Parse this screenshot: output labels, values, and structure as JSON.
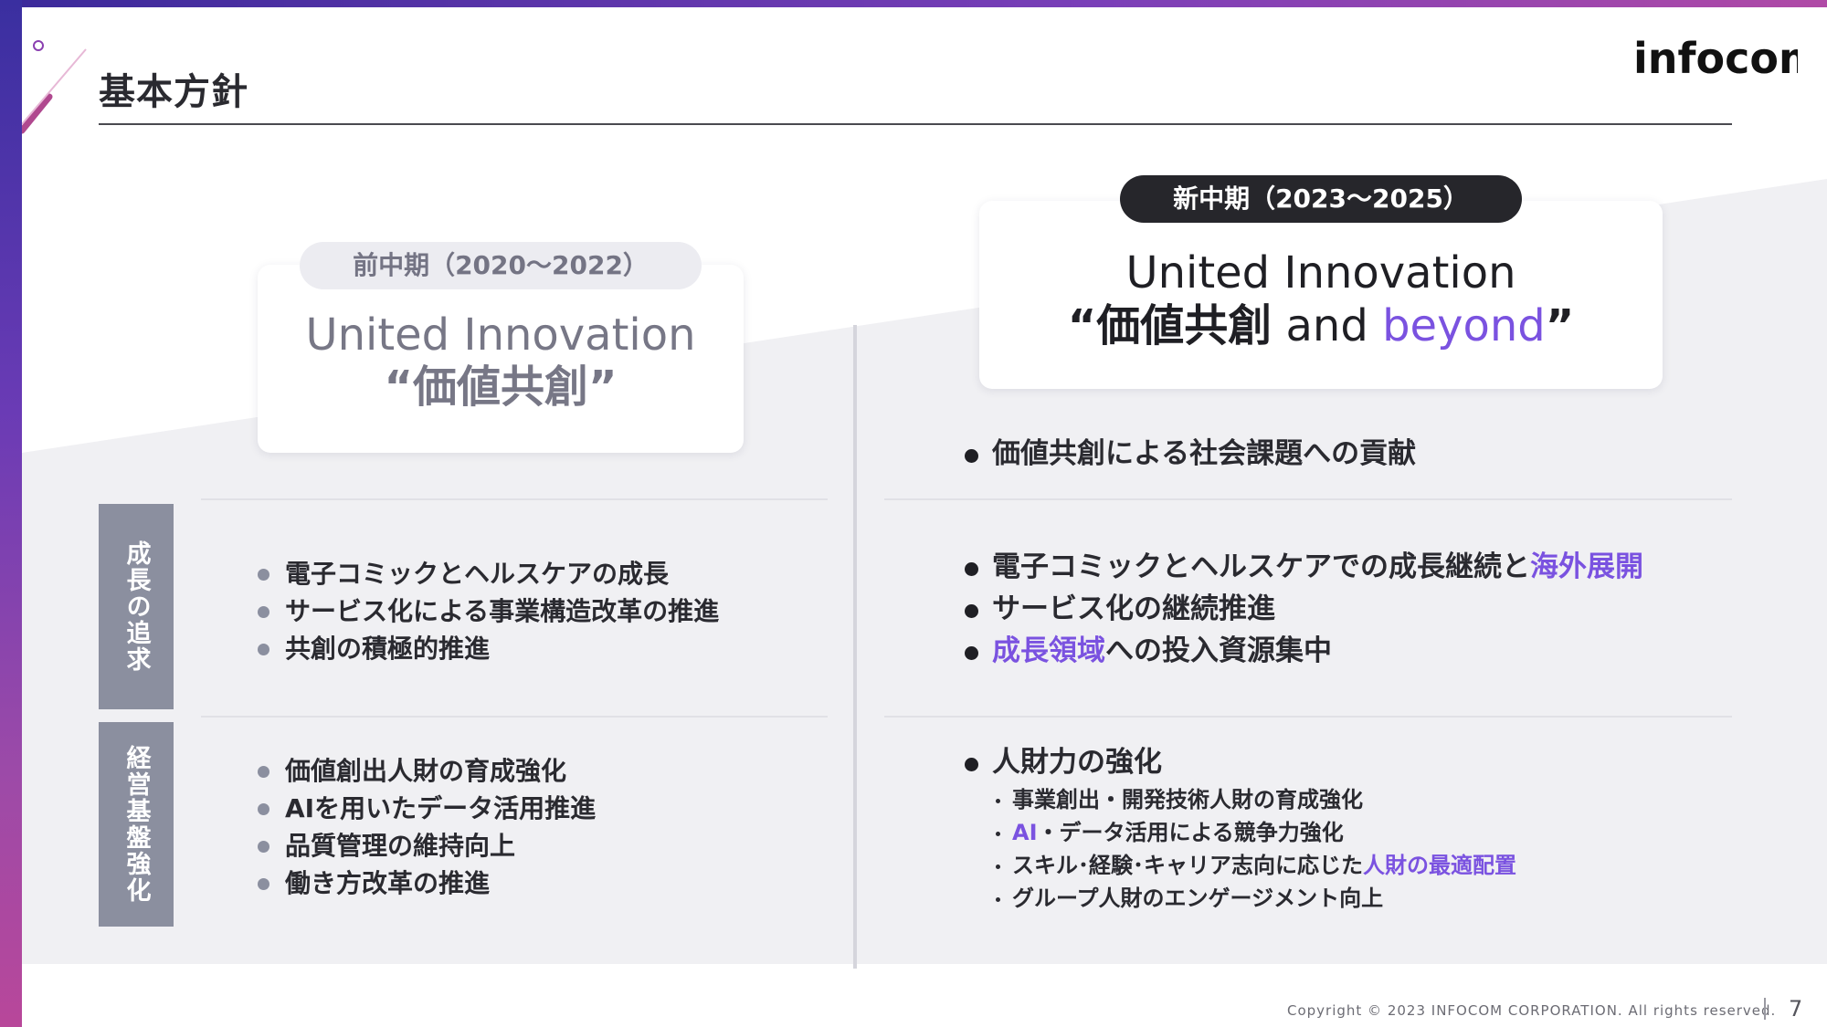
{
  "page": {
    "title": "基本方針",
    "logo_text": "infocom"
  },
  "previous_plan": {
    "period": "前中期（2020〜2022）",
    "slogan_en": "United Innovation",
    "slogan_jp": "“価値共創”",
    "growth": [
      "電子コミックとヘルスケアの成長",
      "サービス化による事業構造改革の推進",
      "共創の積極的推進"
    ],
    "foundation": [
      "価値創出人財の育成強化",
      "AIを用いたデータ活用推進",
      "品質管理の維持向上",
      "働き方改革の推進"
    ]
  },
  "new_plan": {
    "period": "新中期（2023〜2025）",
    "slogan_en": "United Innovation",
    "slogan_jp_open": "“価値共創",
    "slogan_and": " and ",
    "slogan_beyond": "beyond",
    "slogan_close": "”",
    "mission": "価値共創による社会課題への貢献",
    "growth_1_prefix": "電子コミックとヘルスケアでの成長継続と",
    "growth_1_accent": "海外展開",
    "growth_2": "サービス化の継続推進",
    "growth_3_accent": "成長領域",
    "growth_3_suffix": "への投入資源集中",
    "foundation_head": "人財力の強化",
    "sub_1": "事業創出・開発技術人財の育成強化",
    "sub_2_accent": "AI",
    "sub_2_suffix": "・データ活用による競争力強化",
    "sub_3_prefix": "スキル･経験･キャリア志向に応じた",
    "sub_3_accent": "人財の最適配置",
    "sub_4": "グループ人財のエンゲージメント向上"
  },
  "labels": {
    "growth": "成長の追求",
    "foundation": "経営基盤強化"
  },
  "footer": {
    "copyright": "Copyright © 2023 INFOCOM CORPORATION. All rights reserved.",
    "page_number": "7"
  },
  "colors": {
    "accent": "#7a52e0",
    "label_bg": "#8b8f9f",
    "pill_new_bg": "#26262b"
  }
}
